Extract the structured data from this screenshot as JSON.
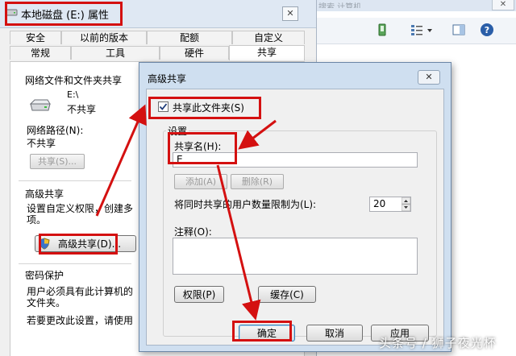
{
  "explorer": {
    "search_text": "搜索 计算机",
    "close_glyph": "✕",
    "icons": [
      "phone-icon",
      "view-icon",
      "preview-pane-icon",
      "help-icon"
    ]
  },
  "properties": {
    "title": "本地磁盘 (E:) 属性",
    "close_glyph": "✕",
    "tabs_row1": [
      "安全",
      "以前的版本",
      "配额",
      "自定义"
    ],
    "tabs_row2": [
      "常规",
      "工具",
      "硬件",
      "共享"
    ],
    "selected_tab": "共享",
    "network_section_title": "网络文件和文件夹共享",
    "drive_path": "E:\\",
    "drive_status": "不共享",
    "network_path_label": "网络路径(N):",
    "network_path_value": "不共享",
    "share_button": "共享(S)...",
    "advanced_title": "高级共享",
    "advanced_desc_line1": "设置自定义权限，创建多",
    "advanced_desc_line2": "项。",
    "advanced_button": "高级共享(D)...",
    "password_title": "密码保护",
    "password_line1": "用户必须具有此计算机的",
    "password_line2": "文件夹。",
    "password_line3": "若要更改此设置，请使用"
  },
  "dialog": {
    "title": "高级共享",
    "close_glyph": "✕",
    "share_checkbox_label": "共享此文件夹(S)",
    "share_checkbox_checked": true,
    "settings_legend": "设置",
    "share_name_label": "共享名(H):",
    "share_name_value": "E",
    "add_button": "添加(A)",
    "remove_button": "删除(R)",
    "user_limit_label": "将同时共享的用户数量限制为(L):",
    "user_limit_value": "20",
    "comment_label": "注释(O):",
    "comment_value": "",
    "permissions_button": "权限(P)",
    "caching_button": "缓存(C)",
    "ok_button": "确定",
    "cancel_button": "取消",
    "apply_button": "应用"
  },
  "watermark": "头条号 / 狮子夜光杯",
  "colors": {
    "annotation_red": "#d41010",
    "dialog_frame": "#cfdff0",
    "window_bg": "#f0f0f0"
  }
}
